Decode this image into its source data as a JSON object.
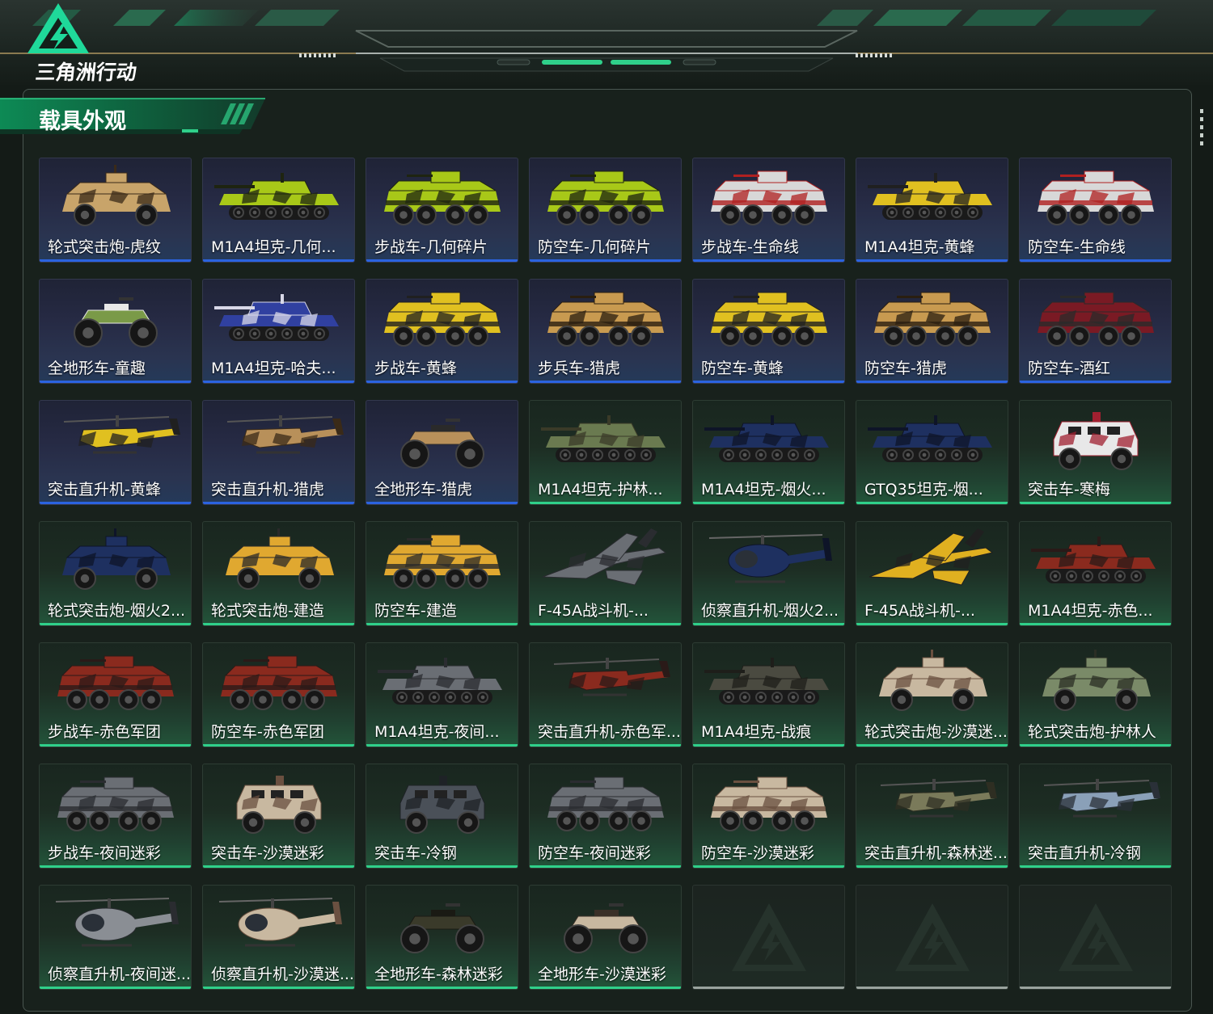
{
  "app": {
    "logo_text": "三角洲行动"
  },
  "section": {
    "title": "载具外观"
  },
  "colors": {
    "accent_green": "#2fd08a",
    "accent_blue": "#2b63e0",
    "empty_bar": "#9aa39e"
  },
  "cards": [
    {
      "label": "轮式突击炮-虎纹",
      "tier": "blue",
      "kind": "wheeled4",
      "colors": [
        "#c8a46a",
        "#3a2a18"
      ]
    },
    {
      "label": "M1A4坦克-几何...",
      "tier": "blue",
      "kind": "tank",
      "colors": [
        "#a8c818",
        "#1e2410"
      ]
    },
    {
      "label": "步战车-几何碎片",
      "tier": "blue",
      "kind": "apc",
      "colors": [
        "#a8c818",
        "#1e2410"
      ]
    },
    {
      "label": "防空车-几何碎片",
      "tier": "blue",
      "kind": "apc",
      "colors": [
        "#a8c818",
        "#1e2410"
      ]
    },
    {
      "label": "步战车-生命线",
      "tier": "blue",
      "kind": "apc",
      "colors": [
        "#d8d8d8",
        "#b02020"
      ]
    },
    {
      "label": "M1A4坦克-黄蜂",
      "tier": "blue",
      "kind": "tank",
      "colors": [
        "#e0c020",
        "#202020"
      ]
    },
    {
      "label": "防空车-生命线",
      "tier": "blue",
      "kind": "apc",
      "colors": [
        "#d8d8d8",
        "#b02020"
      ]
    },
    {
      "label": "全地形车-童趣",
      "tier": "blue",
      "kind": "atv",
      "colors": [
        "#7a9a48",
        "#e8e8e8"
      ]
    },
    {
      "label": "M1A4坦克-哈夫...",
      "tier": "blue",
      "kind": "tank",
      "colors": [
        "#3040a0",
        "#d8d8e8"
      ]
    },
    {
      "label": "步战车-黄蜂",
      "tier": "blue",
      "kind": "apc",
      "colors": [
        "#e0c020",
        "#202020"
      ]
    },
    {
      "label": "步兵车-猎虎",
      "tier": "blue",
      "kind": "apc",
      "colors": [
        "#c89a50",
        "#2a1e10"
      ]
    },
    {
      "label": "防空车-黄蜂",
      "tier": "blue",
      "kind": "apc",
      "colors": [
        "#e0c020",
        "#202020"
      ]
    },
    {
      "label": "防空车-猎虎",
      "tier": "blue",
      "kind": "apc",
      "colors": [
        "#c89a50",
        "#2a1e10"
      ]
    },
    {
      "label": "防空车-酒红",
      "tier": "blue",
      "kind": "apc",
      "colors": [
        "#7a1a24",
        "#2a2a2a"
      ]
    },
    {
      "label": "突击直升机-黄蜂",
      "tier": "blue",
      "kind": "heli",
      "colors": [
        "#e0c020",
        "#202020"
      ]
    },
    {
      "label": "突击直升机-猎虎",
      "tier": "blue",
      "kind": "heli",
      "colors": [
        "#b8905a",
        "#3a2a18"
      ]
    },
    {
      "label": "全地形车-猎虎",
      "tier": "blue",
      "kind": "atv",
      "colors": [
        "#b8905a",
        "#2a2a2a"
      ]
    },
    {
      "label": "M1A4坦克-护林...",
      "tier": "green",
      "kind": "tank",
      "colors": [
        "#6a7a50",
        "#3a3a28"
      ]
    },
    {
      "label": "M1A4坦克-烟火...",
      "tier": "green",
      "kind": "tank",
      "colors": [
        "#1e3060",
        "#0e1428"
      ]
    },
    {
      "label": "GTQ35坦克-烟...",
      "tier": "green",
      "kind": "tank",
      "colors": [
        "#1e3060",
        "#0e1428"
      ]
    },
    {
      "label": "突击车-寒梅",
      "tier": "green",
      "kind": "mrap",
      "colors": [
        "#e8e8e8",
        "#a02030"
      ]
    },
    {
      "label": "轮式突击炮-烟火2...",
      "tier": "green",
      "kind": "wheeled4",
      "colors": [
        "#1e3060",
        "#0e1428"
      ]
    },
    {
      "label": "轮式突击炮-建造",
      "tier": "green",
      "kind": "wheeled4",
      "colors": [
        "#e0a830",
        "#2a2a2a"
      ]
    },
    {
      "label": "防空车-建造",
      "tier": "green",
      "kind": "apc",
      "colors": [
        "#e0a830",
        "#2a2a2a"
      ]
    },
    {
      "label": "F-45A战斗机-...",
      "tier": "green",
      "kind": "jet",
      "colors": [
        "#6a6e74",
        "#2a2c30"
      ]
    },
    {
      "label": "侦察直升机-烟火2...",
      "tier": "green",
      "kind": "lheli",
      "colors": [
        "#1e3060",
        "#0e1428"
      ]
    },
    {
      "label": "F-45A战斗机-...",
      "tier": "green",
      "kind": "jet",
      "colors": [
        "#e0b020",
        "#202020"
      ]
    },
    {
      "label": "M1A4坦克-赤色...",
      "tier": "green",
      "kind": "tank",
      "colors": [
        "#8a2a1e",
        "#2a1a18"
      ]
    },
    {
      "label": "步战车-赤色军团",
      "tier": "green",
      "kind": "apc",
      "colors": [
        "#8a2a1e",
        "#2a1a18"
      ]
    },
    {
      "label": "防空车-赤色军团",
      "tier": "green",
      "kind": "apc",
      "colors": [
        "#8a2a1e",
        "#2a1a18"
      ]
    },
    {
      "label": "M1A4坦克-夜间...",
      "tier": "green",
      "kind": "tank",
      "colors": [
        "#6a6e74",
        "#2a2c30"
      ]
    },
    {
      "label": "突击直升机-赤色军...",
      "tier": "green",
      "kind": "heli",
      "colors": [
        "#8a2a1e",
        "#2a1a18"
      ]
    },
    {
      "label": "M1A4坦克-战痕",
      "tier": "green",
      "kind": "tank",
      "colors": [
        "#4a4a40",
        "#1e1e1a"
      ]
    },
    {
      "label": "轮式突击炮-沙漠迷...",
      "tier": "green",
      "kind": "wheeled4",
      "colors": [
        "#c8b8a0",
        "#6a5040"
      ]
    },
    {
      "label": "轮式突击炮-护林人",
      "tier": "green",
      "kind": "wheeled4",
      "colors": [
        "#7a8a68",
        "#2a2e24"
      ]
    },
    {
      "label": "步战车-夜间迷彩",
      "tier": "green",
      "kind": "apc",
      "colors": [
        "#6a6e74",
        "#2a2c30"
      ]
    },
    {
      "label": "突击车-沙漠迷彩",
      "tier": "green",
      "kind": "mrap",
      "colors": [
        "#c8b8a0",
        "#6a5040"
      ]
    },
    {
      "label": "突击车-冷钢",
      "tier": "green",
      "kind": "mrap",
      "colors": [
        "#4a5058",
        "#1e2226"
      ]
    },
    {
      "label": "防空车-夜间迷彩",
      "tier": "green",
      "kind": "apc",
      "colors": [
        "#6a6e74",
        "#2a2c30"
      ]
    },
    {
      "label": "防空车-沙漠迷彩",
      "tier": "green",
      "kind": "apc",
      "colors": [
        "#c8b8a0",
        "#6a5040"
      ]
    },
    {
      "label": "突击直升机-森林迷...",
      "tier": "green",
      "kind": "heli",
      "colors": [
        "#7a7a5a",
        "#2e2e22"
      ]
    },
    {
      "label": "突击直升机-冷钢",
      "tier": "green",
      "kind": "heli",
      "colors": [
        "#8aa0b8",
        "#2a3038"
      ]
    },
    {
      "label": "侦察直升机-夜间迷...",
      "tier": "green",
      "kind": "lheli",
      "colors": [
        "#8a8e94",
        "#2a2c30"
      ]
    },
    {
      "label": "侦察直升机-沙漠迷...",
      "tier": "green",
      "kind": "lheli",
      "colors": [
        "#c8b8a0",
        "#6a5040"
      ]
    },
    {
      "label": "全地形车-森林迷彩",
      "tier": "green",
      "kind": "atv",
      "colors": [
        "#3a3a2a",
        "#1a1a14"
      ]
    },
    {
      "label": "全地形车-沙漠迷彩",
      "tier": "green",
      "kind": "atv",
      "colors": [
        "#c8b8a0",
        "#3a3028"
      ]
    },
    {
      "label": "",
      "tier": "empty",
      "kind": "none",
      "colors": []
    },
    {
      "label": "",
      "tier": "empty",
      "kind": "none",
      "colors": []
    },
    {
      "label": "",
      "tier": "empty",
      "kind": "none",
      "colors": []
    }
  ]
}
